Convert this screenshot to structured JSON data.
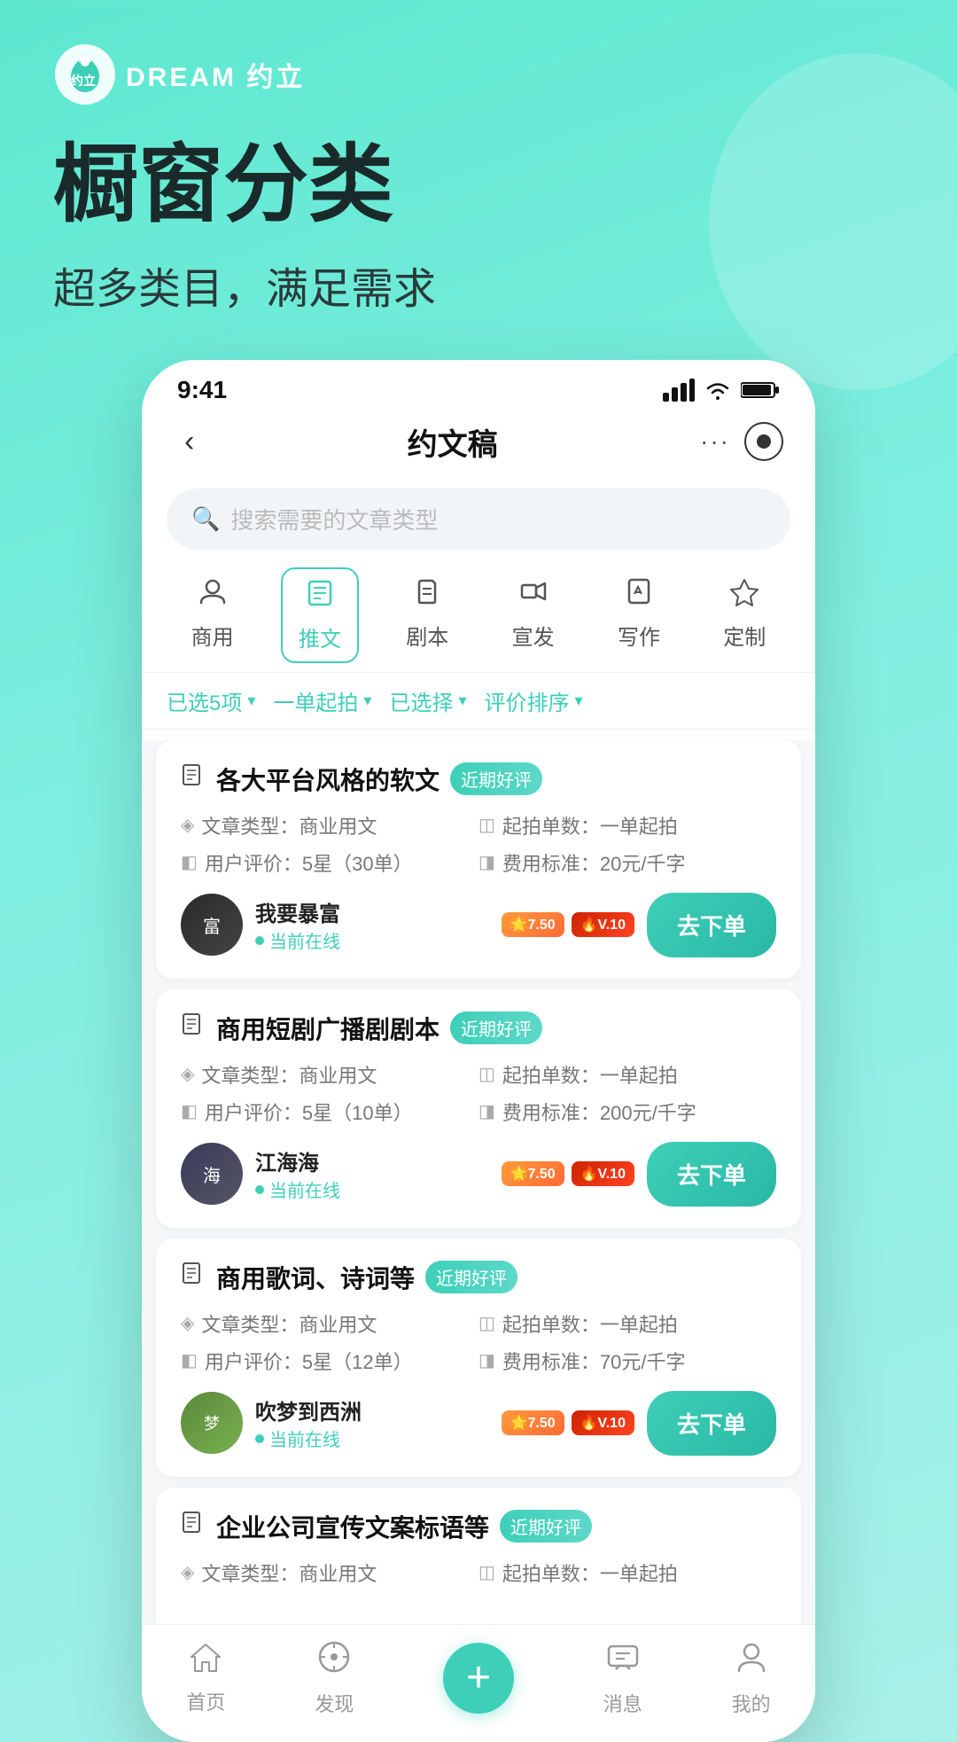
{
  "brand": {
    "name": "DREAM 约立"
  },
  "header": {
    "title": "橱窗分类",
    "subtitle": "超多类目，满足需求"
  },
  "statusBar": {
    "time": "9:41"
  },
  "navBar": {
    "back": "‹",
    "title": "约文稿",
    "dots": "···"
  },
  "search": {
    "placeholder": "搜索需要的文章类型"
  },
  "categories": [
    {
      "id": "shangyong",
      "label": "商用",
      "icon": "👤",
      "active": false
    },
    {
      "id": "tuiwen",
      "label": "推文",
      "icon": "📋",
      "active": true
    },
    {
      "id": "juben",
      "label": "剧本",
      "icon": "✏️",
      "active": false
    },
    {
      "id": "xuanfa",
      "label": "宣发",
      "icon": "📢",
      "active": false
    },
    {
      "id": "xiezuo",
      "label": "写作",
      "icon": "✍️",
      "active": false
    },
    {
      "id": "dingzhi",
      "label": "定制",
      "icon": "◇",
      "active": false
    }
  ],
  "filters": [
    {
      "label": "已选5项",
      "arrow": "▾"
    },
    {
      "label": "一单起拍",
      "arrow": "▾"
    },
    {
      "label": "已选择",
      "arrow": "▾"
    },
    {
      "label": "评价排序",
      "arrow": "▾"
    }
  ],
  "services": [
    {
      "id": 1,
      "title": "各大平台风格的软文",
      "badge": "近期好评",
      "articleType": "文章类型：商业用文",
      "minOrder": "起拍单数：一单起拍",
      "userRating": "用户评价：5星（30单）",
      "pricingStd": "费用标准：20元/千字",
      "sellerName": "我要暴富",
      "sellerOnline": "当前在线",
      "orderBtn": "去下单",
      "avatarText": "富",
      "avatarClass": "avatar-woyao"
    },
    {
      "id": 2,
      "title": "商用短剧广播剧剧本",
      "badge": "近期好评",
      "articleType": "文章类型：商业用文",
      "minOrder": "起拍单数：一单起拍",
      "userRating": "用户评价：5星（10单）",
      "pricingStd": "费用标准：200元/千字",
      "sellerName": "江海海",
      "sellerOnline": "当前在线",
      "orderBtn": "去下单",
      "avatarText": "海",
      "avatarClass": "avatar-jianghai"
    },
    {
      "id": 3,
      "title": "商用歌词、诗词等",
      "badge": "近期好评",
      "articleType": "文章类型：商业用文",
      "minOrder": "起拍单数：一单起拍",
      "userRating": "用户评价：5星（12单）",
      "pricingStd": "费用标准：70元/千字",
      "sellerName": "吹梦到西洲",
      "sellerOnline": "当前在线",
      "orderBtn": "去下单",
      "avatarText": "梦",
      "avatarClass": "avatar-chuimeng"
    },
    {
      "id": 4,
      "title": "企业公司宣传文案标语等",
      "badge": "近期好评",
      "articleType": "文章类型：商业用文",
      "minOrder": "起拍单数：一单起拍",
      "userRating": "",
      "pricingStd": "",
      "sellerName": "",
      "sellerOnline": "",
      "orderBtn": "",
      "avatarText": "",
      "avatarClass": ""
    }
  ],
  "bottomNav": {
    "items": [
      {
        "id": "home",
        "label": "首页",
        "icon": "⌂"
      },
      {
        "id": "discover",
        "label": "发现",
        "icon": "◎"
      },
      {
        "id": "plus",
        "label": "",
        "icon": "+"
      },
      {
        "id": "message",
        "label": "消息",
        "icon": "💬"
      },
      {
        "id": "mine",
        "label": "我的",
        "icon": "👤"
      }
    ]
  }
}
